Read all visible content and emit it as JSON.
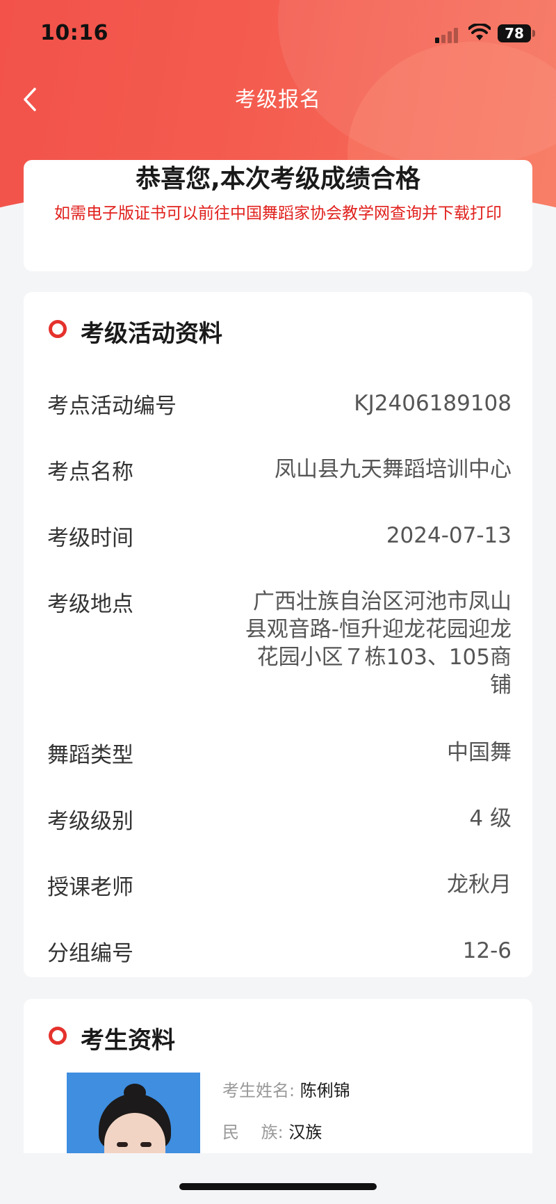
{
  "status_bar": {
    "time": "10:16",
    "battery": "78",
    "icons": [
      "cellular-signal-icon",
      "wifi-icon",
      "battery-icon"
    ]
  },
  "nav": {
    "back_icon": "chevron-left-icon",
    "title": "考级报名"
  },
  "result": {
    "title": "恭喜您,本次考级成绩合格",
    "note": "如需电子版证书可以前往中国舞蹈家协会教学网查询并下载打印"
  },
  "exam_section": {
    "title": "考级活动资料",
    "rows": [
      {
        "label": "考点活动编号",
        "value": "KJ2406189108"
      },
      {
        "label": "考点名称",
        "value": "凤山县九天舞蹈培训中心"
      },
      {
        "label": "考级时间",
        "value": "2024-07-13"
      },
      {
        "label": "考级地点",
        "value": "广西壮族自治区河池市凤山县观音路-恒升迎龙花园迎龙花园小区７栋103、105商铺"
      },
      {
        "label": "舞蹈类型",
        "value": "中国舞"
      },
      {
        "label": "考级级别",
        "value": "4 级"
      },
      {
        "label": "授课老师",
        "value": "龙秋月"
      },
      {
        "label": "分组编号",
        "value": "12-6"
      }
    ]
  },
  "student_section": {
    "title": "考生资料",
    "name_label": "考生姓名:",
    "name": "陈俐锦",
    "ethnicity_label": "民　 族:",
    "ethnicity": "汉族"
  },
  "colors": {
    "header_red": "#f2524a",
    "accent_red": "#e5322c",
    "note_red": "#e0201c",
    "background": "#f4f5f7"
  }
}
